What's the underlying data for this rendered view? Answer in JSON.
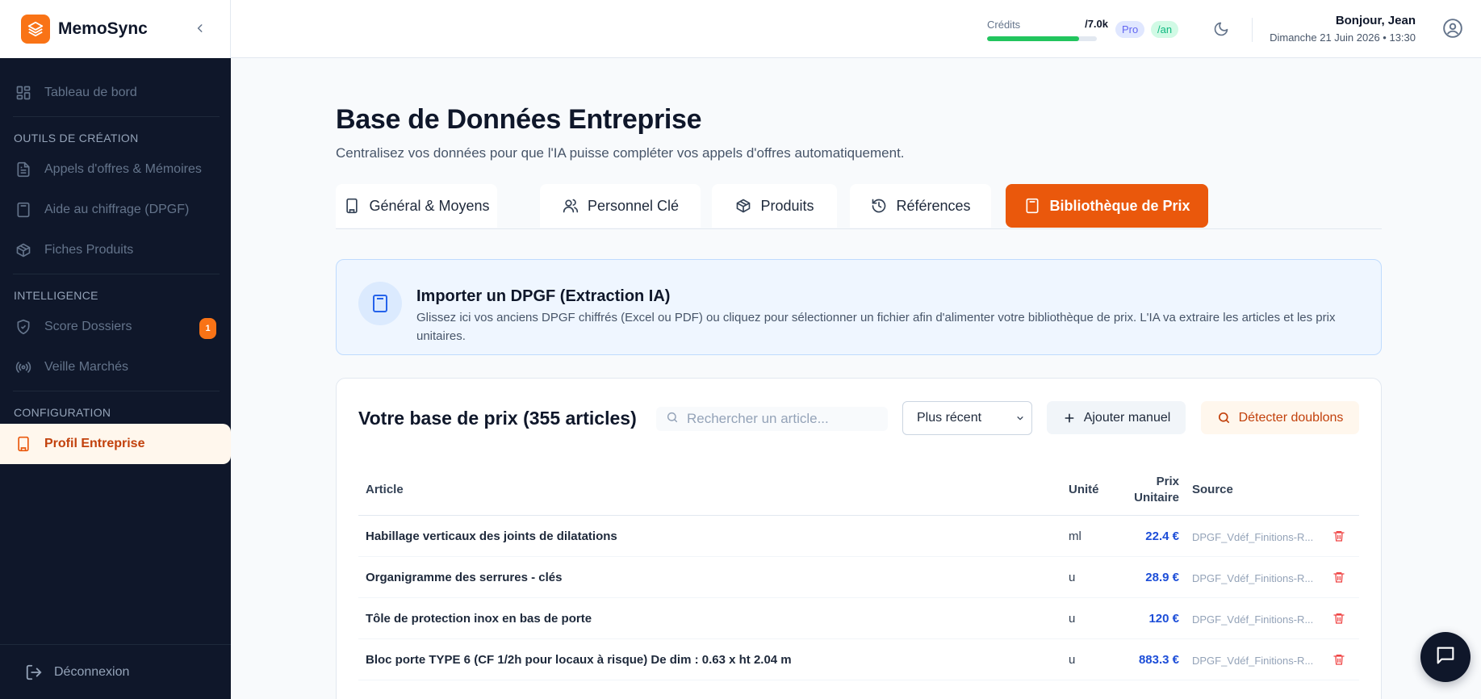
{
  "sidebar": {
    "brand": "MemoSync",
    "items": {
      "dashboard": "Tableau de bord",
      "section_creation": "OUTILS DE CRÉATION",
      "tenders": "Appels d'offres & Mémoires",
      "pricing": "Aide au chiffrage (DPGF)",
      "products": "Fiches Produits",
      "section_intel": "INTELLIGENCE",
      "score": "Score Dossiers",
      "score_badge": "1",
      "watch": "Veille Marchés",
      "section_config": "CONFIGURATION",
      "profile": "Profil Entreprise"
    },
    "logout": "Déconnexion"
  },
  "topbar": {
    "credits_label": "Crédits",
    "credits_value": "/7.0k",
    "credits_progress": 0.84,
    "plan_badge": "Pro",
    "period_badge": "/an",
    "greeting": "Bonjour, Jean",
    "date": "Dimanche 21 Juin 2026 • 13:30"
  },
  "page": {
    "title": "Base de Données Entreprise",
    "subtitle": "Centralisez vos données pour que l'IA puisse compléter vos appels d'offres automatiquement."
  },
  "tabs": {
    "general": "Général & Moyens",
    "staff": "Personnel Clé",
    "products": "Produits",
    "references": "Références",
    "prices": "Bibliothèque de Prix"
  },
  "import": {
    "title": "Importer un DPGF (Extraction IA)",
    "description": "Glissez ici vos anciens DPGF chiffrés (Excel ou PDF) ou cliquez pour sélectionner un fichier afin d'alimenter votre bibliothèque de prix. L'IA va extraire les articles et les prix unitaires."
  },
  "library": {
    "title": "Votre base de prix (355 articles)",
    "search_placeholder": "Rechercher un article...",
    "sort_selected": "Plus récent",
    "add_button": "Ajouter manuel",
    "dedupe_button": "Détecter doublons",
    "columns": {
      "article": "Article",
      "unit": "Unité",
      "price_line1": "Prix",
      "price_line2": "Unitaire",
      "source": "Source"
    },
    "rows": [
      {
        "article": "Habillage verticaux des joints de dilatations",
        "unit": "ml",
        "price": "22.4 €",
        "source": "DPGF_Vdéf_Finitions-R..."
      },
      {
        "article": "Organigramme des serrures - clés",
        "unit": "u",
        "price": "28.9 €",
        "source": "DPGF_Vdéf_Finitions-R..."
      },
      {
        "article": "Tôle de protection inox en bas de porte",
        "unit": "u",
        "price": "120 €",
        "source": "DPGF_Vdéf_Finitions-R..."
      },
      {
        "article": "Bloc porte TYPE 6 (CF 1/2h pour locaux à risque) De dim : 0.63 x ht 2.04 m",
        "unit": "u",
        "price": "883.3 €",
        "source": "DPGF_Vdéf_Finitions-R..."
      }
    ]
  },
  "colors": {
    "accent": "#ea580c",
    "sidebar_bg": "#0f172a",
    "price_blue": "#1d4ed8",
    "delete_red": "#ef4444"
  }
}
